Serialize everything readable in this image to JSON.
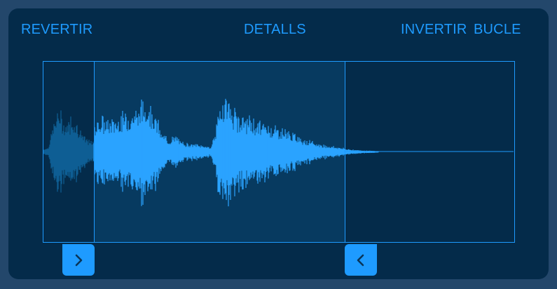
{
  "toolbar": {
    "revert_label": "REVERTIR",
    "details_label": "DETALLS",
    "reverse_label": "INVERTIR",
    "loop_label": "BUCLE"
  },
  "icons": {
    "start_handle": "chevron-right-icon",
    "end_handle": "chevron-left-icon"
  },
  "colors": {
    "accent": "#1e9bff",
    "background": "#23476b",
    "panel": "#042b4a",
    "selected_region": "#073a60",
    "waveform_dimmed": "#0f5f94"
  }
}
